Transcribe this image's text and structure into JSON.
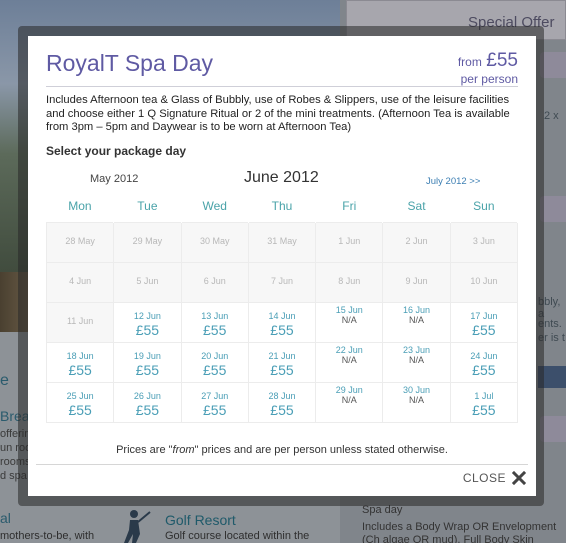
{
  "background": {
    "special_offer": "Special Offer",
    "left_word_1": "e",
    "left_word_2": "Brea",
    "left_lines": [
      "offering",
      "un roo",
      "rooms",
      "d spa"
    ],
    "left_word_3": "al",
    "mothers_text": "mothers-to-be, with",
    "golf_title": "Golf Resort",
    "golf_text": "Golf course located within the",
    "right_fragments": [
      "2 x",
      "bbly, a",
      "ents.",
      "er is t"
    ],
    "spa_title": "Spa day",
    "spa_text": "Includes a Body Wrap OR Envelopment (Ch algae OR mud), Full Body Skin Brushing Th"
  },
  "modal": {
    "title": "RoyalT Spa Day",
    "price_from_label": "from",
    "price_amount": "£55",
    "price_per": "per person",
    "description": "Includes Afternoon tea & Glass of Bubbly, use of Robes & Slippers, use of the leisure facilities and choose either 1 Q Signature Ritual or 2 of the mini treatments. (Afternoon Tea is available from 3pm – 5pm and Daywear is to be worn at Afternoon Tea)",
    "select_label": "Select your package day",
    "prev_month": "May 2012",
    "current_month": "June 2012",
    "next_month": "July 2012 >>",
    "weekdays": [
      "Mon",
      "Tue",
      "Wed",
      "Thu",
      "Fri",
      "Sat",
      "Sun"
    ],
    "weeks": [
      [
        {
          "date": "28 May",
          "state": "past"
        },
        {
          "date": "29 May",
          "state": "past"
        },
        {
          "date": "30 May",
          "state": "past"
        },
        {
          "date": "31 May",
          "state": "past"
        },
        {
          "date": "1 Jun",
          "state": "past"
        },
        {
          "date": "2 Jun",
          "state": "past"
        },
        {
          "date": "3 Jun",
          "state": "past"
        }
      ],
      [
        {
          "date": "4 Jun",
          "state": "past"
        },
        {
          "date": "5 Jun",
          "state": "past"
        },
        {
          "date": "6 Jun",
          "state": "past"
        },
        {
          "date": "7 Jun",
          "state": "past"
        },
        {
          "date": "8 Jun",
          "state": "past"
        },
        {
          "date": "9 Jun",
          "state": "past"
        },
        {
          "date": "10 Jun",
          "state": "past"
        }
      ],
      [
        {
          "date": "11 Jun",
          "state": "past"
        },
        {
          "date": "12 Jun",
          "state": "avail",
          "price": "£55"
        },
        {
          "date": "13 Jun",
          "state": "avail",
          "price": "£55"
        },
        {
          "date": "14 Jun",
          "state": "avail",
          "price": "£55"
        },
        {
          "date": "15 Jun",
          "state": "na",
          "status": "N/A"
        },
        {
          "date": "16 Jun",
          "state": "na",
          "status": "N/A"
        },
        {
          "date": "17 Jun",
          "state": "avail",
          "price": "£55"
        }
      ],
      [
        {
          "date": "18 Jun",
          "state": "avail",
          "price": "£55"
        },
        {
          "date": "19 Jun",
          "state": "avail",
          "price": "£55"
        },
        {
          "date": "20 Jun",
          "state": "avail",
          "price": "£55"
        },
        {
          "date": "21 Jun",
          "state": "avail",
          "price": "£55"
        },
        {
          "date": "22 Jun",
          "state": "na",
          "status": "N/A"
        },
        {
          "date": "23 Jun",
          "state": "na",
          "status": "N/A"
        },
        {
          "date": "24 Jun",
          "state": "avail",
          "price": "£55"
        }
      ],
      [
        {
          "date": "25 Jun",
          "state": "avail",
          "price": "£55"
        },
        {
          "date": "26 Jun",
          "state": "avail",
          "price": "£55"
        },
        {
          "date": "27 Jun",
          "state": "avail",
          "price": "£55"
        },
        {
          "date": "28 Jun",
          "state": "avail",
          "price": "£55"
        },
        {
          "date": "29 Jun",
          "state": "na",
          "status": "N/A"
        },
        {
          "date": "30 Jun",
          "state": "na",
          "status": "N/A"
        },
        {
          "date": "1 Jul",
          "state": "avail",
          "price": "£55"
        }
      ]
    ],
    "note_before": "Prices are \"",
    "note_em": "from",
    "note_after": "\" prices and are per person unless stated otherwise.",
    "close_label": "CLOSE",
    "close_icon": "close-x-icon"
  },
  "colors": {
    "title": "#5f5aa3",
    "accent_teal": "#4a9eb6",
    "link_blue": "#3d7fb3"
  }
}
